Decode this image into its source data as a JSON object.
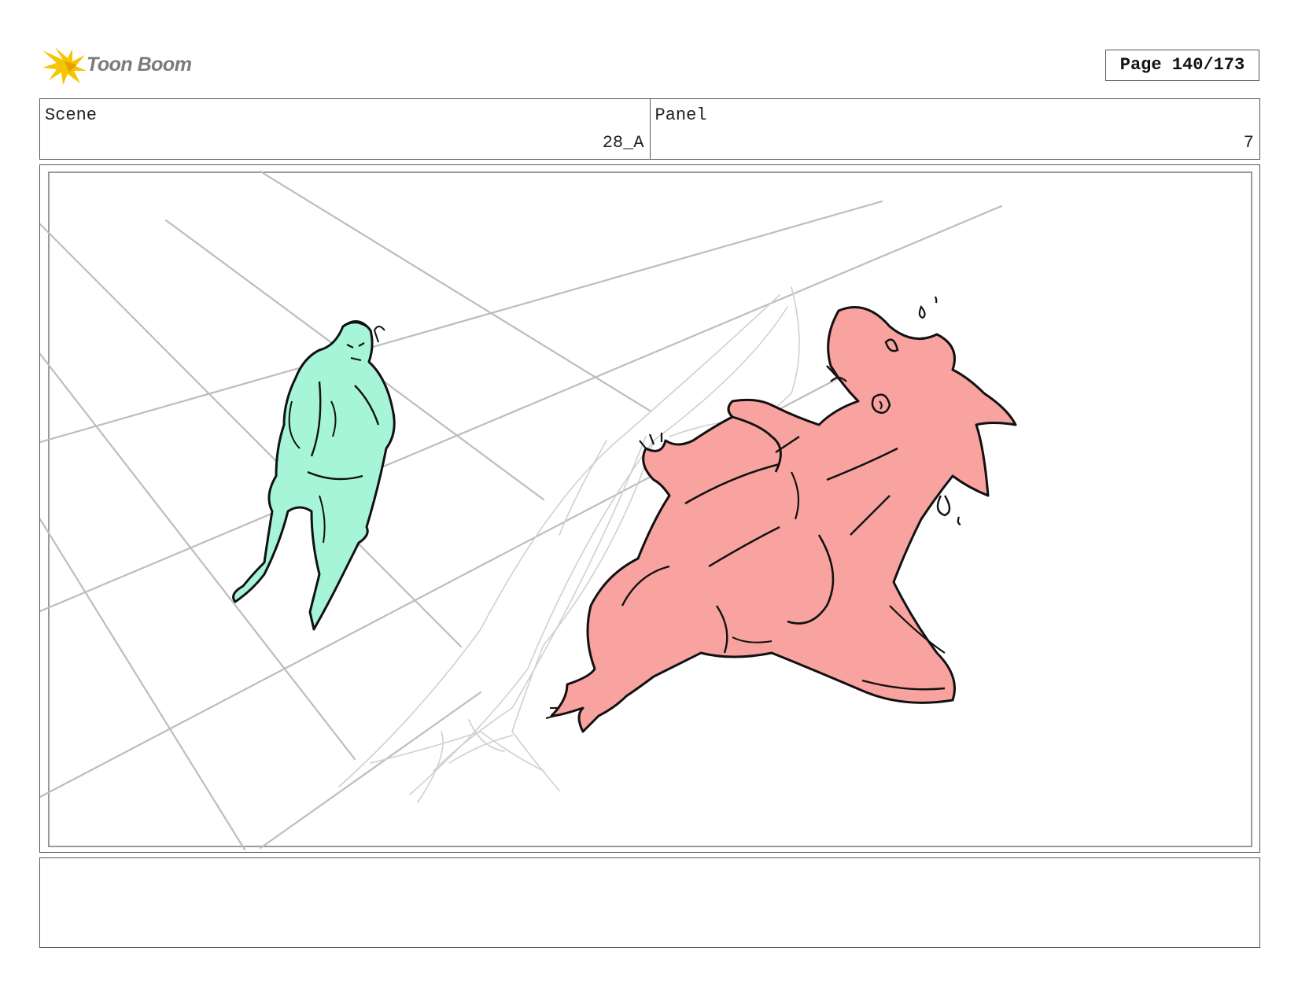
{
  "header": {
    "logo_text": "Toon Boom",
    "page_label": "Page 140/173"
  },
  "scene": {
    "label": "Scene",
    "value": "28_A"
  },
  "panel": {
    "label": "Panel",
    "value": "7"
  },
  "notes": {
    "text": ""
  },
  "colors": {
    "human_fill": "#a6f5d8",
    "creature_fill": "#f9a3a1",
    "perspective_lines": "#bdbdbd",
    "ink": "#111111",
    "logo_star": "#f7c400"
  }
}
